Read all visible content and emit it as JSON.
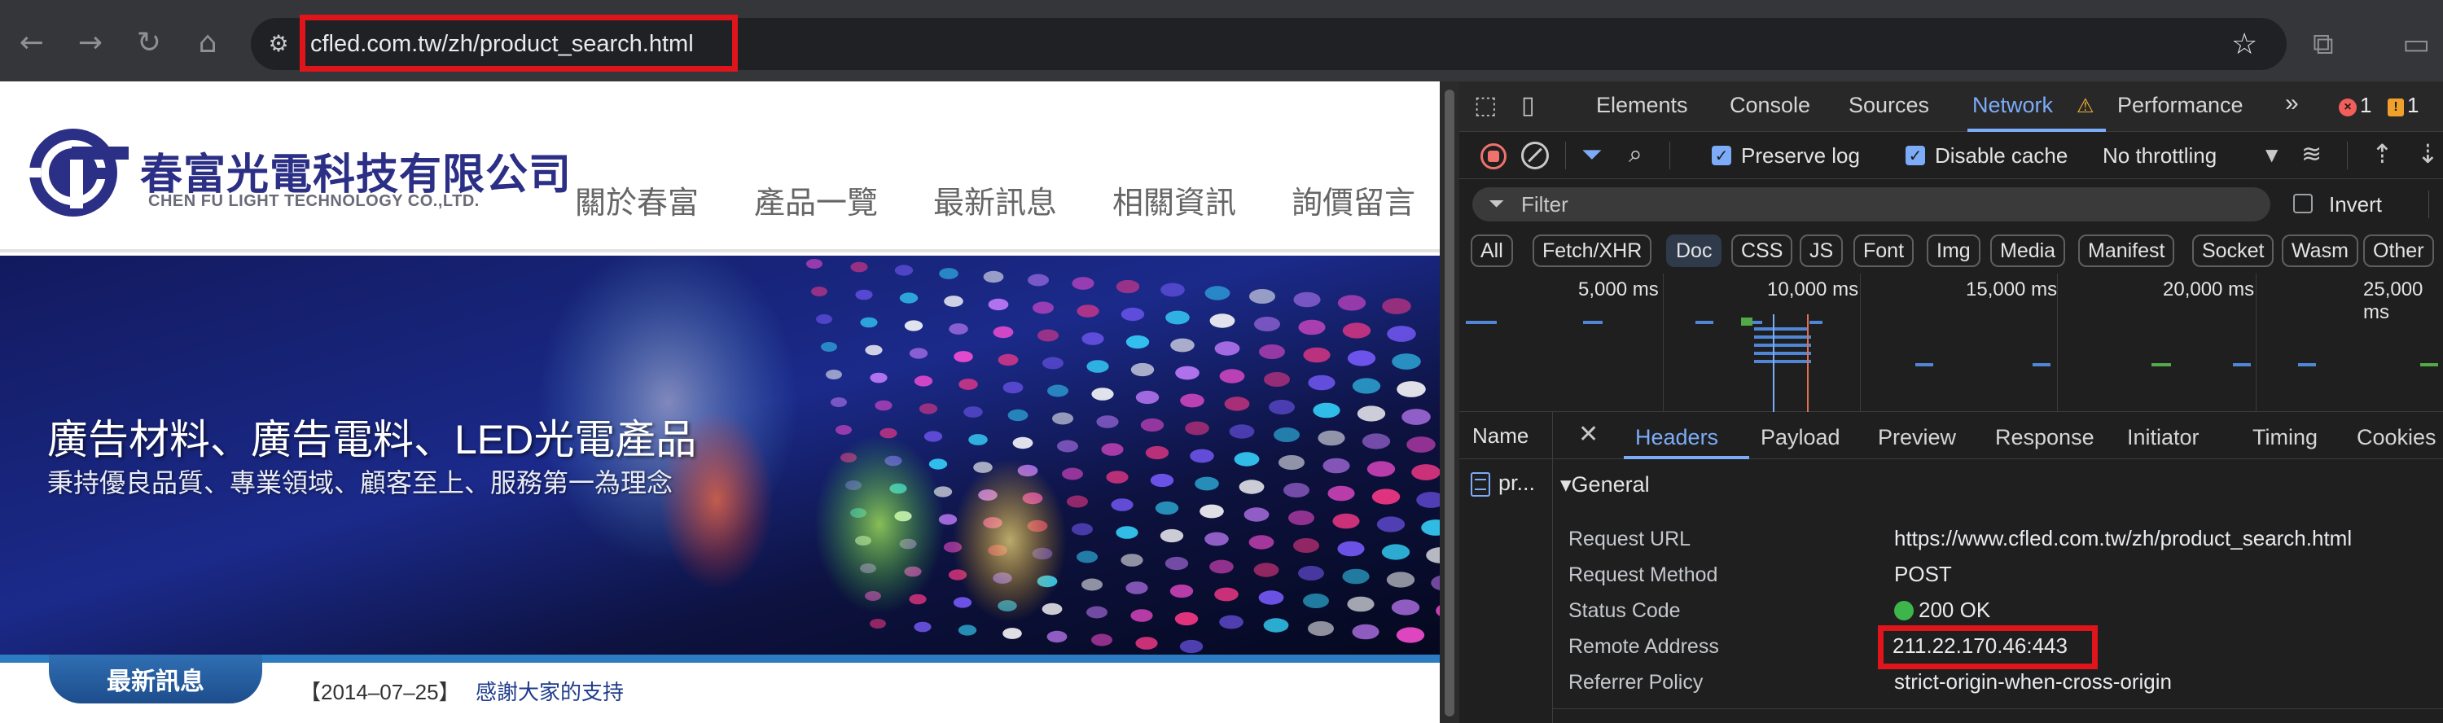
{
  "browser": {
    "url": "cfled.com.tw/zh/product_search.html",
    "icons": [
      "back-icon",
      "forward-icon",
      "reload-icon",
      "home-icon",
      "site-info-icon",
      "bookmark-star-icon",
      "extensions-icon",
      "side-panel-icon"
    ]
  },
  "site": {
    "company_zh": "春富光電科技有限公司",
    "company_en": "CHEN FU LIGHT TECHNOLOGY CO.,LTD.",
    "nav": [
      "關於春富",
      "產品一覽",
      "最新訊息",
      "相關資訊",
      "詢價留言"
    ],
    "banner_title": "廣告材料、廣告電料、LED光電產品",
    "banner_subtitle": "秉持優良品質、專業領域、顧客至上、服務第一為理念",
    "news_tab": "最新訊息",
    "news_date": "【2014–07–25】",
    "news_link": "感謝大家的支持"
  },
  "devtools": {
    "tabs": [
      "Elements",
      "Console",
      "Sources",
      "Network",
      "Performance"
    ],
    "more_tabs": "»",
    "error_count": "1",
    "warning_count": "1",
    "preserve_log": "Preserve log",
    "disable_cache": "Disable cache",
    "throttling": "No throttling",
    "filter_placeholder": "Filter",
    "invert": "Invert",
    "type_filters": [
      "All",
      "Fetch/XHR",
      "Doc",
      "CSS",
      "JS",
      "Font",
      "Img",
      "Media",
      "Manifest",
      "Socket",
      "Wasm",
      "Other"
    ],
    "active_type": "Doc",
    "timeline_labels": [
      "5,000 ms",
      "10,000 ms",
      "15,000 ms",
      "20,000 ms",
      "25,000 ms"
    ],
    "name_column": "Name",
    "detail_tabs": [
      "Headers",
      "Payload",
      "Preview",
      "Response",
      "Initiator",
      "Timing",
      "Cookies"
    ],
    "request_name": "pr...",
    "general_section": "▾General",
    "headers": [
      {
        "key": "Request URL",
        "value": "https://www.cfled.com.tw/zh/product_search.html"
      },
      {
        "key": "Request Method",
        "value": "POST"
      },
      {
        "key": "Status Code",
        "value": "200 OK"
      },
      {
        "key": "Remote Address",
        "value": "211.22.170.46:443"
      },
      {
        "key": "Referrer Policy",
        "value": "strict-origin-when-cross-origin"
      }
    ],
    "colors": {
      "accent": "#7cacf8",
      "highlight": "#e0141b",
      "status_ok": "#3cb54a"
    }
  }
}
